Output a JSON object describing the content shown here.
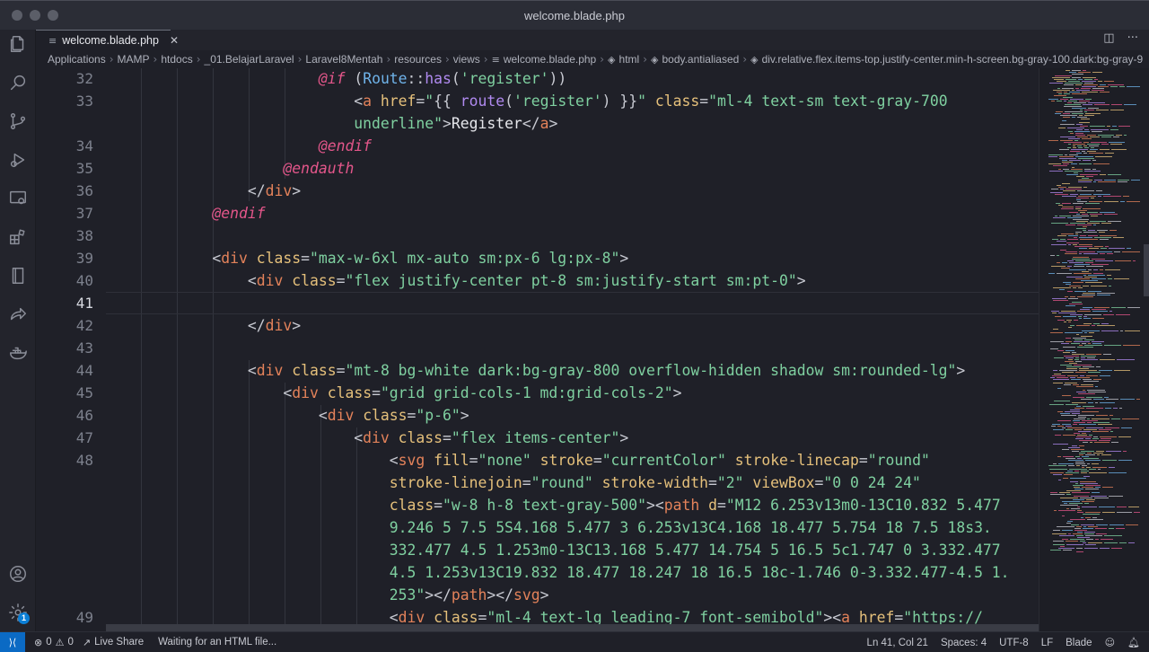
{
  "window": {
    "title": "welcome.blade.php"
  },
  "tabs": [
    {
      "label": "welcome.blade.php",
      "close": "✕"
    }
  ],
  "breadcrumb": [
    "Applications",
    "MAMP",
    "htdocs",
    "_01.BelajarLaravel",
    "Laravel8Mentah",
    "resources",
    "views",
    "welcome.blade.php",
    "html",
    "body.antialiased",
    "div.relative.flex.items-top.justify-center.min-h-screen.bg-gray-100.dark:bg-gray-9"
  ],
  "editor": {
    "gutter": [
      "32",
      "33",
      "",
      "34",
      "35",
      "36",
      "37",
      "38",
      "39",
      "40",
      "41",
      "42",
      "43",
      "44",
      "45",
      "46",
      "47",
      "48",
      "",
      "",
      "",
      "",
      "",
      "",
      "49"
    ]
  },
  "statusbar": {
    "errors": "0",
    "warnings": "0",
    "live_share": "Live Share",
    "message": "Waiting for an HTML file...",
    "position": "Ln 41, Col 21",
    "spaces": "Spaces: 4",
    "encoding": "UTF-8",
    "eol": "LF",
    "language": "Blade"
  },
  "activity_badge": "1",
  "colors": {
    "accent": "#0b6ac4",
    "background": "#1f2028"
  }
}
